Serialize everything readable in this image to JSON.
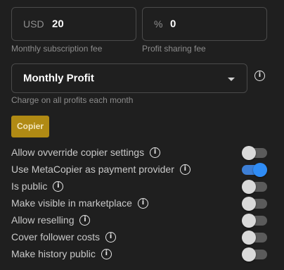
{
  "subscription": {
    "currency_prefix": "USD",
    "value": "20",
    "helper": "Monthly subscription fee"
  },
  "profit_share": {
    "prefix": "%",
    "value": "0",
    "helper": "Profit sharing fee"
  },
  "charge_mode": {
    "selected": "Monthly Profit",
    "helper": "Charge on all profits each month"
  },
  "copier_button_label": "Copier",
  "colors": {
    "accent_gold": "#b08a14",
    "toggle_on": "#2f8cf5",
    "background": "#1f1f1f"
  },
  "settings": [
    {
      "label": "Allow ovverride copier settings",
      "on": false
    },
    {
      "label": "Use MetaCopier as payment provider",
      "on": true
    },
    {
      "label": "Is public",
      "on": false
    },
    {
      "label": "Make visible in marketplace",
      "on": false
    },
    {
      "label": "Allow reselling",
      "on": false
    },
    {
      "label": "Cover follower costs",
      "on": false
    },
    {
      "label": "Make history public",
      "on": false
    }
  ],
  "icons": {
    "info": "info-icon",
    "dropdown": "chevron-down-icon"
  }
}
